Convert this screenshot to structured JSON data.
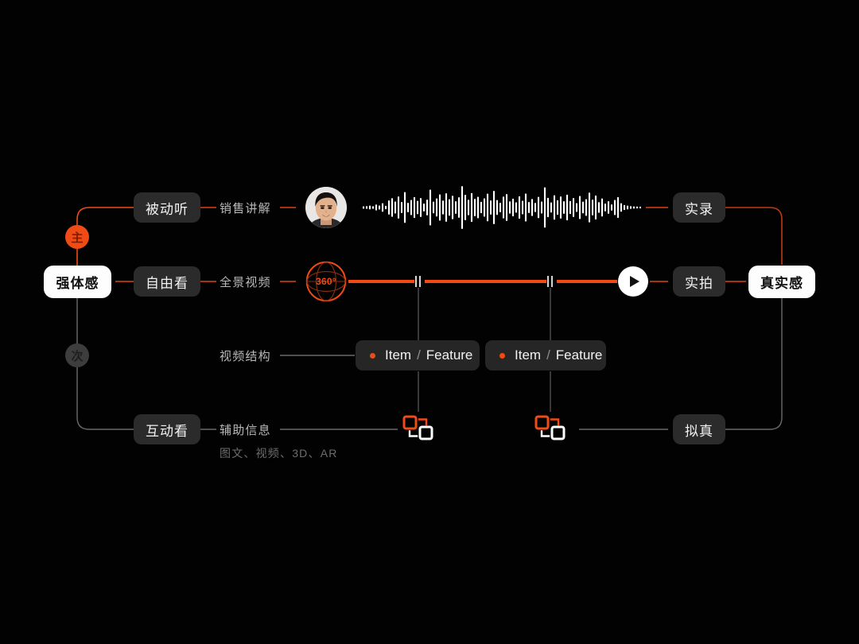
{
  "theme": {
    "background": "#020202",
    "accent": "#F04B14",
    "chip_bg": "#2b2b2b",
    "chip_text": "#f2f2f2",
    "muted_text": "#b9b9b9",
    "dim_text": "#6d6d6d",
    "wire_gray": "#6a6a6a",
    "light_chip_bg": "#fdfdfd",
    "light_chip_text": "#111111"
  },
  "diagram": {
    "root": {
      "label": "强体感"
    },
    "end": {
      "label": "真实感"
    },
    "markers": {
      "primary": "主",
      "secondary": "次"
    },
    "rows": [
      {
        "id": "passive-listen",
        "mode": "被动听",
        "channel": "销售讲解",
        "outcome": "实录"
      },
      {
        "id": "free-view",
        "mode": "自由看",
        "channel": "全景视频",
        "outcome": "实拍"
      },
      {
        "id": "interactive-view",
        "mode": "互动看",
        "channel": "辅助信息",
        "channel_sub": "图文、视频、3D、AR",
        "outcome": "拟真"
      }
    ],
    "structure": {
      "label": "视频结构",
      "items": [
        {
          "name": "Item",
          "separator": "/",
          "feature": "Feature"
        },
        {
          "name": "Item",
          "separator": "/",
          "feature": "Feature"
        }
      ]
    },
    "player": {
      "badge_360": "360°",
      "play_icon": "play-icon",
      "pause_marker_icon": "pause-marker-icon",
      "waveform_icon": "audio-waveform",
      "avatar_icon": "presenter-avatar",
      "duplicate_icon": "duplicate-squares-icon"
    }
  }
}
